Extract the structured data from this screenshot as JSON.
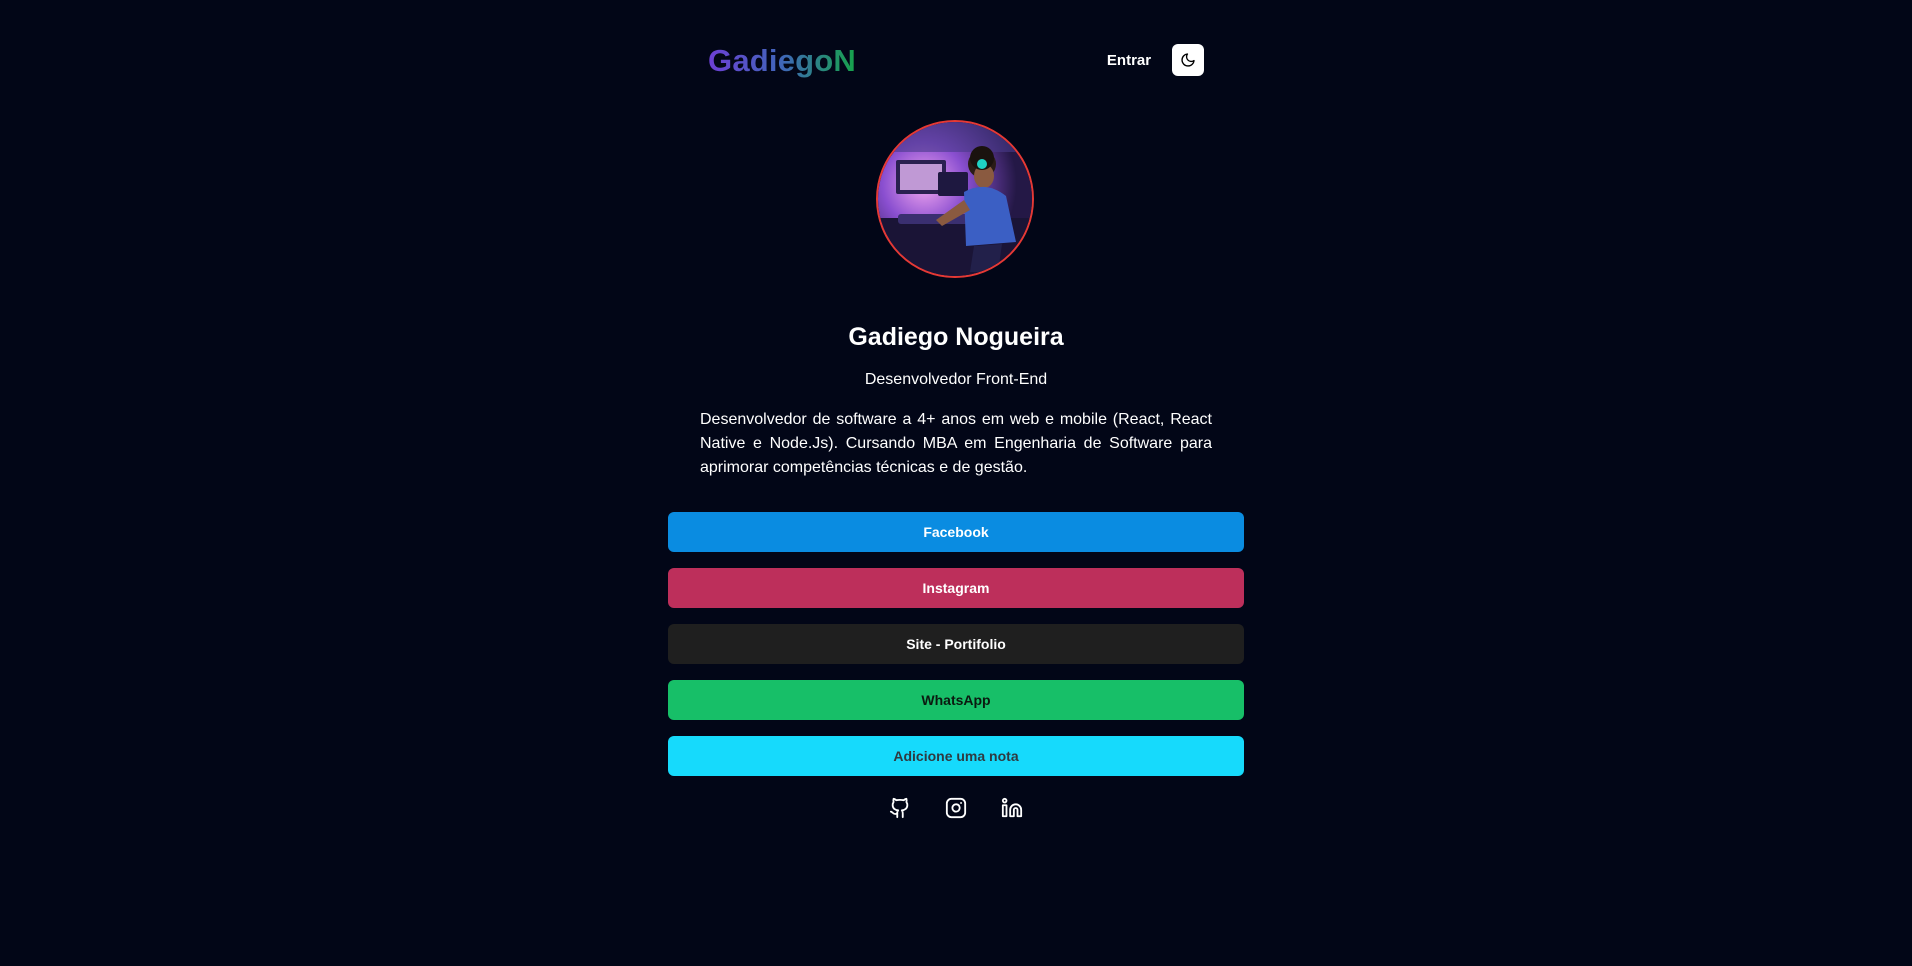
{
  "header": {
    "logo": "GadiegoN",
    "login_label": "Entrar",
    "theme_icon": "moon-icon"
  },
  "profile": {
    "name": "Gadiego Nogueira",
    "role": "Desenvolvedor Front-End",
    "bio": "Desenvolvedor de software a 4+ anos em web e mobile (React, React Native e Node.Js). Cursando MBA em Engenharia de Software para aprimorar competências técnicas e de gestão.",
    "avatar_border_color": "#e53935"
  },
  "links": [
    {
      "label": "Facebook",
      "bg": "#0a8ce1",
      "color": "#ffffff"
    },
    {
      "label": "Instagram",
      "bg": "#bd2f5b",
      "color": "#ffffff"
    },
    {
      "label": "Site - Portifolio",
      "bg": "#1f1f1f",
      "color": "#ffffff"
    },
    {
      "label": "WhatsApp",
      "bg": "#17bf68",
      "color": "#0b1a10"
    },
    {
      "label": "Adicione uma nota",
      "bg": "#16dafc",
      "color": "#2f3a40"
    }
  ],
  "social": [
    {
      "icon": "github-icon"
    },
    {
      "icon": "instagram-icon"
    },
    {
      "icon": "linkedin-icon"
    }
  ],
  "colors": {
    "background": "#020617",
    "text": "#ffffff"
  }
}
